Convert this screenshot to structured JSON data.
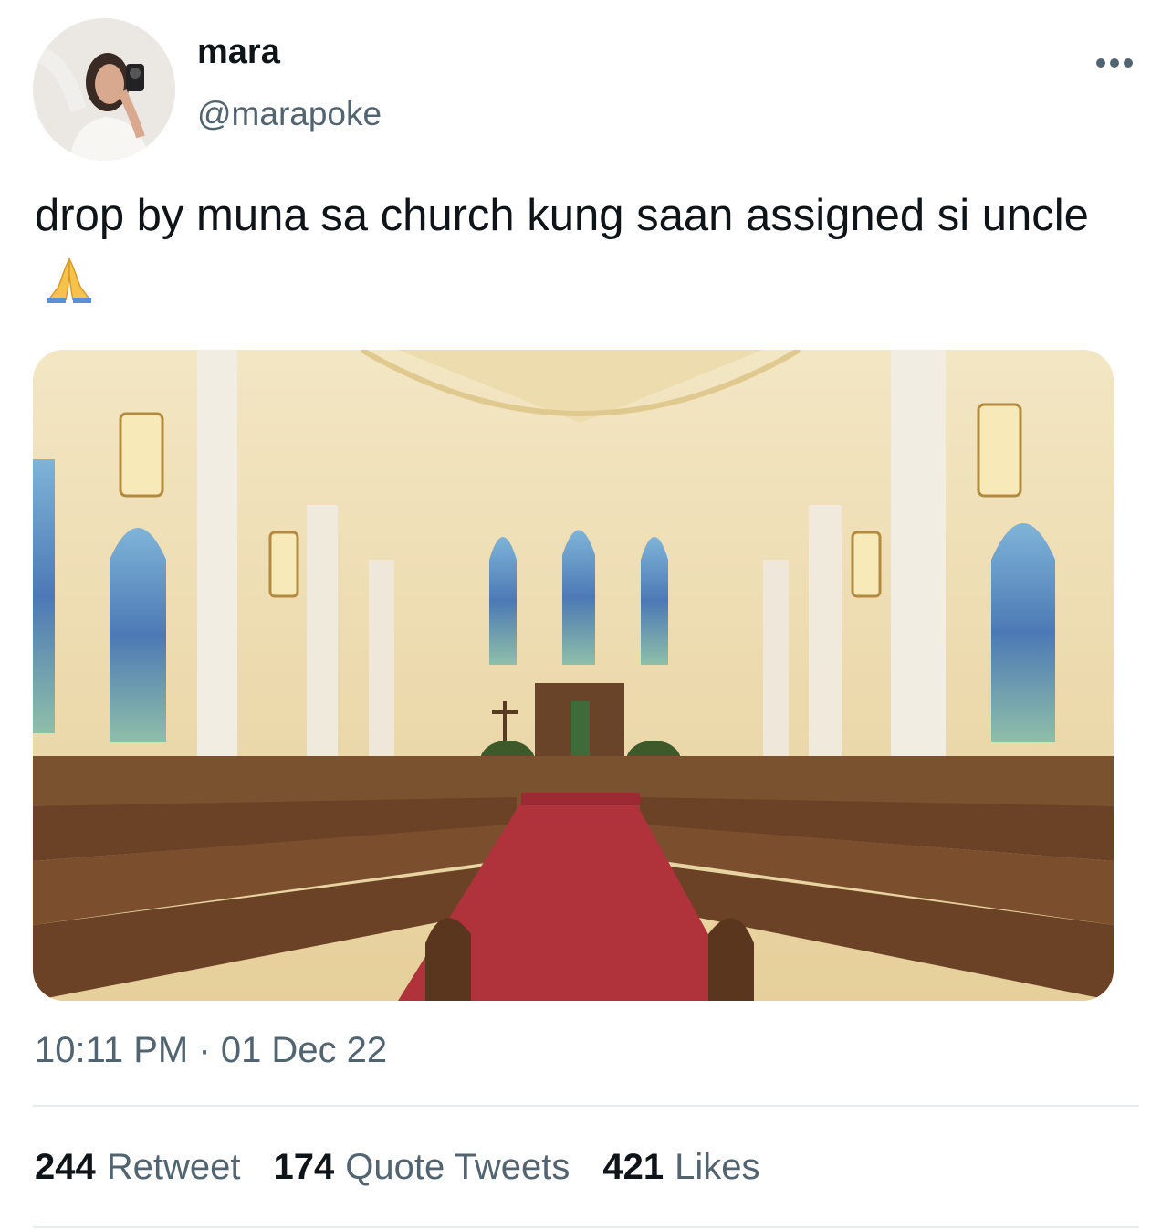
{
  "author": {
    "display_name": "mara",
    "handle": "@marapoke",
    "avatar_icon": "profile-photo"
  },
  "header": {
    "more_icon": "ellipsis-icon"
  },
  "tweet": {
    "text": "drop by muna sa church kung saan assigned si uncle",
    "emoji_icon": "folded-hands-emoji"
  },
  "media": {
    "description_icon": "church-interior-photo"
  },
  "meta": {
    "time": "10:11 PM",
    "separator": "·",
    "date": "01 Dec 22"
  },
  "stats": {
    "retweets": {
      "count": "244",
      "label": "Retweet"
    },
    "quotes": {
      "count": "174",
      "label": "Quote Tweets"
    },
    "likes": {
      "count": "421",
      "label": "Likes"
    }
  },
  "colors": {
    "text": "#0f1419",
    "secondary": "#536471",
    "divider": "#e6ecf0",
    "carpet": "#b0323a"
  }
}
